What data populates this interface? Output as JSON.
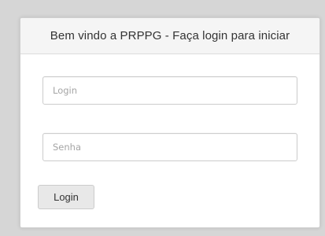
{
  "login_panel": {
    "title": "Bem vindo a PRPPG - Faça login para iniciar",
    "login_field": {
      "value": "",
      "placeholder": "Login"
    },
    "password_field": {
      "value": "",
      "placeholder": "Senha"
    },
    "submit_label": "Login"
  }
}
